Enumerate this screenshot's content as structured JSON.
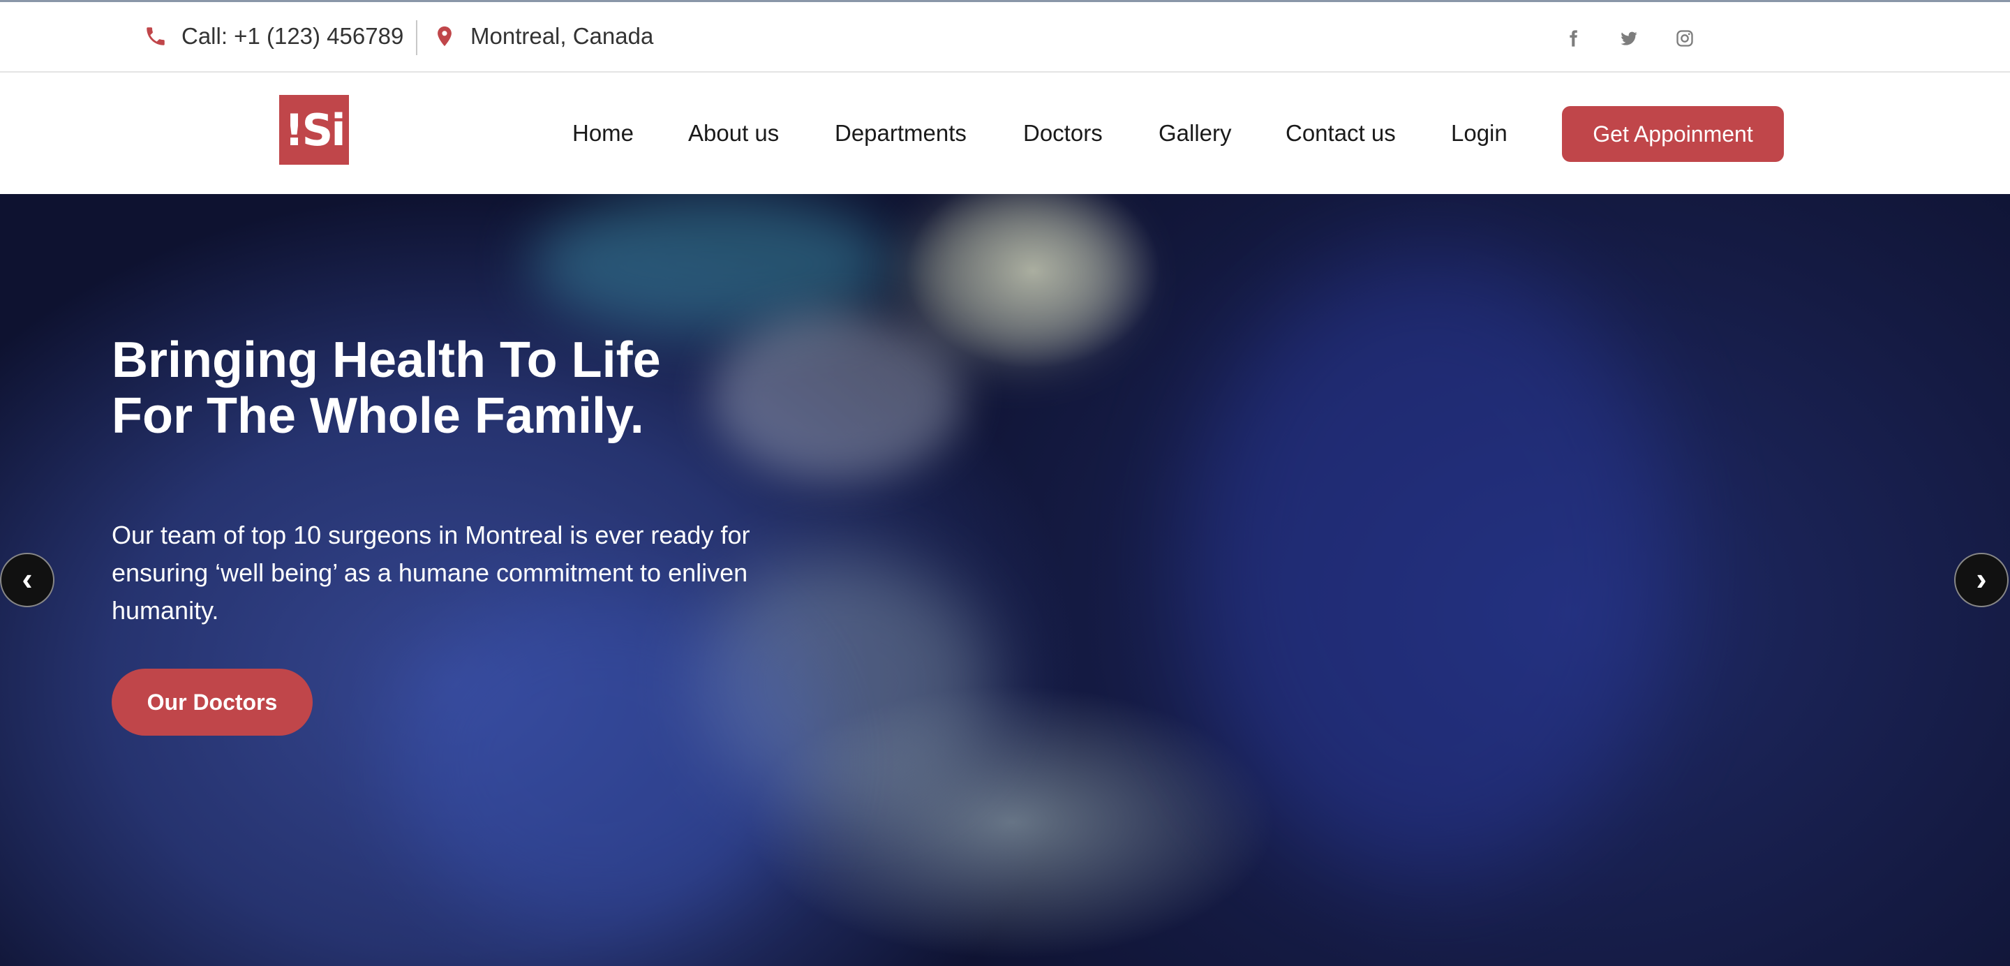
{
  "topbar": {
    "phone": "Call: +1 (123) 456789",
    "location": "Montreal, Canada",
    "social": [
      "facebook-icon",
      "twitter-icon",
      "instagram-icon"
    ]
  },
  "header": {
    "logo_text": "!Si",
    "nav": [
      "Home",
      "About us",
      "Departments",
      "Doctors",
      "Gallery",
      "Contact us",
      "Login"
    ],
    "cta_label": "Get Appoinment"
  },
  "hero": {
    "title_line1": "Bringing Health To Life",
    "title_line2": "For The Whole Family.",
    "description": "Our team of top 10 surgeons in Montreal is ever ready for ensuring ‘well being’ as a humane commitment to enliven humanity.",
    "button_label": "Our Doctors",
    "prev_arrow": "‹",
    "next_arrow": "›"
  },
  "colors": {
    "accent": "#c0464a",
    "text": "#1a1a1a"
  }
}
